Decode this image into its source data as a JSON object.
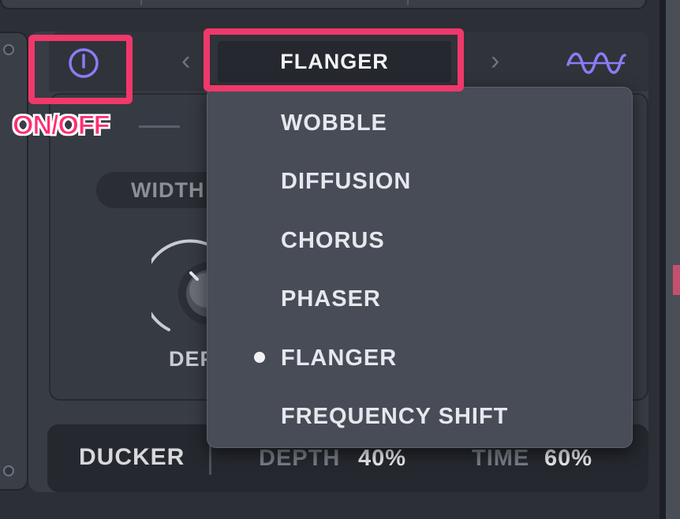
{
  "module": {
    "preset_name": "FLANGER",
    "prev_arrow": "‹",
    "next_arrow": "›"
  },
  "annotation": {
    "onoff_label": "ON/OFF"
  },
  "controls": {
    "width_label": "WIDTH",
    "depth_label": "DEP"
  },
  "dropdown": {
    "selected": "FLANGER",
    "items": [
      "WOBBLE",
      "DIFFUSION",
      "CHORUS",
      "PHASER",
      "FLANGER",
      "FREQUENCY SHIFT"
    ]
  },
  "ducker": {
    "title": "DUCKER",
    "depth_label": "DEPTH",
    "depth_value": "40%",
    "time_label": "TIME",
    "time_value": "60%"
  },
  "colors": {
    "highlight": "#f0386a",
    "accent_purple": "#8b7cf6",
    "onoff_text": "#ff2d72"
  },
  "icons": {
    "power": "power-icon",
    "waveform": "lfo-wave-icon"
  }
}
